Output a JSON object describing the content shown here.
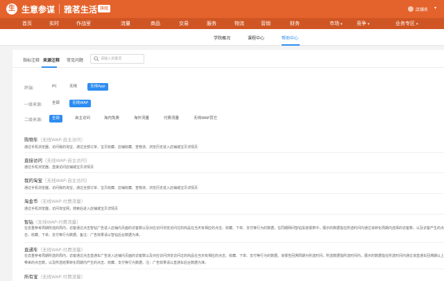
{
  "header": {
    "logo_char": "生",
    "brand": "生意参谋",
    "shop_name": "雅茗生活",
    "tag": "旗舰",
    "user_name": "店铺名",
    "user_caret": "▾"
  },
  "nav": {
    "items": [
      "首页",
      "实时",
      "作战室",
      "流量",
      "商品",
      "交易",
      "服务",
      "物流",
      "营销",
      "财务",
      "市场",
      "竞争",
      "业务专区"
    ],
    "caret": "▾"
  },
  "subnav": {
    "items": [
      "学院概况",
      "课程中心",
      "帮助中心"
    ],
    "active_index": 2
  },
  "panel": {
    "tabs": [
      "指标注释",
      "来源注释",
      "常见问题"
    ],
    "active_tab": 1,
    "search_placeholder": "请输入关键词"
  },
  "filters": {
    "terminal": {
      "label": "终端:",
      "options": [
        "PC",
        "无线",
        "无线App"
      ],
      "active": 2
    },
    "level1": {
      "label": "一级来源:",
      "options": [
        "全部",
        "无线WAP"
      ],
      "active": 1
    },
    "level2": {
      "label": "二级来源:",
      "options": [
        "全部",
        "自主访问",
        "淘内免费",
        "淘外流量",
        "付费流量",
        "无线WAP其它"
      ],
      "active": 0
    }
  },
  "sections": [
    {
      "title": "购物车",
      "paren": "（无线WAP-自主访问）",
      "desc": "通过手机浏览器，访问我的淘宝，通过全部订单、宝贝收藏、店铺收藏、查物流、浏览历史进入店铺或宝贝详情页"
    },
    {
      "title": "直接访问",
      "paren": "（无线WAP-自主访问）",
      "desc": "通过手机浏览器，直接访问店铺或宝贝详情页"
    },
    {
      "title": "我的淘宝",
      "paren": "（无线WAP-自主访问）",
      "desc": "通过手机浏览器，访问我的淘宝，通过全部订单、宝贝收藏、店铺收藏、查物流、浏览历史进入店铺或宝贝详情页"
    },
    {
      "title": "淘金币",
      "paren": "（无线WAP-付费流量）",
      "desc": "通过手机浏览器，访问淘宝网，搜索后进入店铺或宝贝详情页"
    },
    {
      "title": "智钻",
      "paren": "（无线WAP-付费流量）",
      "desc": "在去重参考周期所选的周内，访客通过点击智钻广告进入店铺内页面的访客数以及对应访问浏览访问过的商品在当天有相应的点击、收藏、下单、支付等行为的数据。在同期网间智钻投放报表中，展示的数据指在所选时间内通过该转化周期内选择的访客数，以及访客产生的点击、收藏、下单、支付等行为数据。备注：广告效果请以智钻后台数据为准。"
    },
    {
      "title": "直通车",
      "paren": "（无线WAP-付费流量）",
      "desc": "在去重参考周期所选的周内，访客通过点击直通车广告进入店铺内页面的访客数以及对应访问浏览访问过的商品在当天有相应的点击、收藏、下单、支付等行为的数据。该报告回溯周期为所选时间，所选数据指所选时间内，展示的数据指在所选时间内通过该直通车回溯期以上带来的点击数，以及所选结果转化周期内产生的点击、收藏、支付等行为数据。注：广告效果请以直通车后台数据为准。"
    },
    {
      "title": "所有宝",
      "paren": "（无线WAP-付费流量）",
      "desc": ""
    }
  ]
}
